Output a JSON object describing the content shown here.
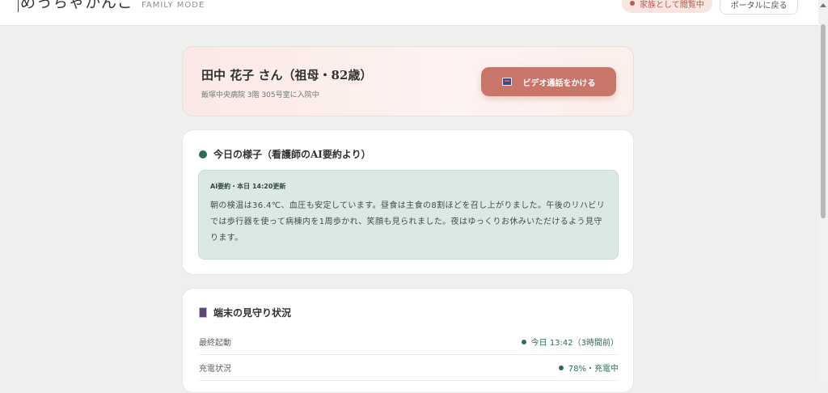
{
  "header": {
    "brand_name": "めっちゃかんご",
    "brand_mode": "FAMILY MODE",
    "viewing_badge": "家族として閲覧中",
    "portal_button": "ポータルに戻る"
  },
  "patient": {
    "name": "田中 花子 さん（祖母・82歳）",
    "location": "飯塚中央病院 3階 305号室に入院中",
    "video_call_label": "ビデオ通話をかける"
  },
  "summary": {
    "title": "今日の様子（看護師のAI要約より）",
    "meta": "AI要約・本日 14:20更新",
    "text": "朝の検温は36.4℃、血圧も安定しています。昼食は主食の8割ほどを召し上がりました。午後のリハビリでは歩行器を使って病棟内を1周歩かれ、笑顔も見られました。夜はゆっくりお休みいただけるよう見守ります。"
  },
  "device": {
    "title": "端末の見守り状況",
    "rows": [
      {
        "label": "最終起動",
        "value": "今日 13:42（3時間前）"
      },
      {
        "label": "充電状況",
        "value": "78%・充電中"
      }
    ]
  },
  "colors": {
    "accent_green": "#2f6b58",
    "accent_coral": "#c8766a",
    "badge_bg": "#f8e4e0"
  }
}
